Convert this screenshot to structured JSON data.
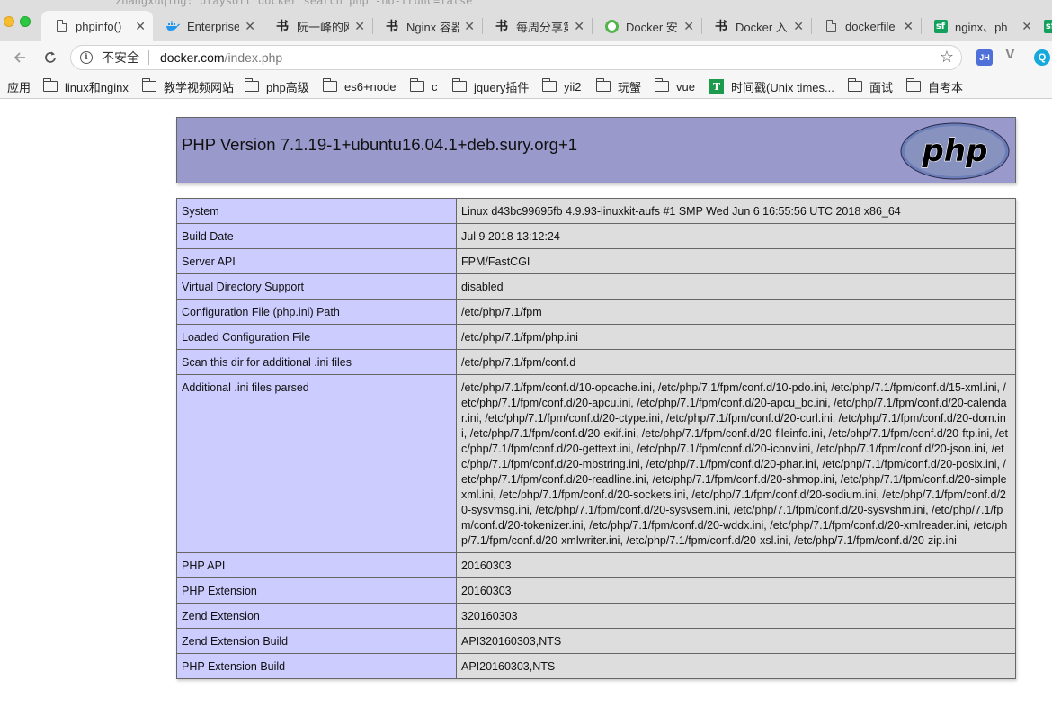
{
  "terminal_overlay": "zhangxuqing:  playsoft docker search php  -no-trunc=false",
  "tabs": [
    {
      "title": "phpinfo()",
      "icon": "document-icon",
      "active": true
    },
    {
      "title": "Enterprise",
      "icon": "docker-whale-icon"
    },
    {
      "title": "阮一峰的网",
      "icon": "jianshu-icon"
    },
    {
      "title": "Nginx 容器",
      "icon": "jianshu-icon"
    },
    {
      "title": "每周分享第",
      "icon": "jianshu-icon"
    },
    {
      "title": "Docker 安",
      "icon": "green-ring-icon"
    },
    {
      "title": "Docker 入",
      "icon": "jianshu-icon"
    },
    {
      "title": "dockerfile",
      "icon": "document-icon"
    },
    {
      "title": "nginx、ph",
      "icon": "segmentfault-icon"
    }
  ],
  "address_bar": {
    "security_label": "不安全",
    "url_host": "docker.com",
    "url_path": "/index.php"
  },
  "extensions": [
    "JH",
    "V",
    "Q"
  ],
  "bookmarks": [
    {
      "label": "应用",
      "icon": "none"
    },
    {
      "label": "linux和nginx",
      "icon": "folder-icon"
    },
    {
      "label": "教学视频网站",
      "icon": "folder-icon"
    },
    {
      "label": "php高级",
      "icon": "folder-icon"
    },
    {
      "label": "es6+node",
      "icon": "folder-icon"
    },
    {
      "label": "c",
      "icon": "folder-icon"
    },
    {
      "label": "jquery插件",
      "icon": "folder-icon"
    },
    {
      "label": "yii2",
      "icon": "folder-icon"
    },
    {
      "label": "玩蟹",
      "icon": "folder-icon"
    },
    {
      "label": "vue",
      "icon": "folder-icon"
    },
    {
      "label": "时间戳(Unix times...",
      "icon": "timestamp-icon"
    },
    {
      "label": "面试",
      "icon": "folder-icon"
    },
    {
      "label": "自考本",
      "icon": "folder-icon"
    }
  ],
  "php": {
    "version_title": "PHP Version 7.1.19-1+ubuntu16.04.1+deb.sury.org+1",
    "logo_text": "php",
    "rows": [
      {
        "key": "System",
        "value": "Linux d43bc99695fb 4.9.93-linuxkit-aufs #1 SMP Wed Jun 6 16:55:56 UTC 2018 x86_64"
      },
      {
        "key": "Build Date",
        "value": "Jul 9 2018 13:12:24"
      },
      {
        "key": "Server API",
        "value": "FPM/FastCGI"
      },
      {
        "key": "Virtual Directory Support",
        "value": "disabled"
      },
      {
        "key": "Configuration File (php.ini) Path",
        "value": "/etc/php/7.1/fpm"
      },
      {
        "key": "Loaded Configuration File",
        "value": "/etc/php/7.1/fpm/php.ini"
      },
      {
        "key": "Scan this dir for additional .ini files",
        "value": "/etc/php/7.1/fpm/conf.d"
      },
      {
        "key": "Additional .ini files parsed",
        "value": "/etc/php/7.1/fpm/conf.d/10-opcache.ini, /etc/php/7.1/fpm/conf.d/10-pdo.ini, /etc/php/7.1/fpm/conf.d/15-xml.ini, /etc/php/7.1/fpm/conf.d/20-apcu.ini, /etc/php/7.1/fpm/conf.d/20-apcu_bc.ini, /etc/php/7.1/fpm/conf.d/20-calendar.ini, /etc/php/7.1/fpm/conf.d/20-ctype.ini, /etc/php/7.1/fpm/conf.d/20-curl.ini, /etc/php/7.1/fpm/conf.d/20-dom.ini, /etc/php/7.1/fpm/conf.d/20-exif.ini, /etc/php/7.1/fpm/conf.d/20-fileinfo.ini, /etc/php/7.1/fpm/conf.d/20-ftp.ini, /etc/php/7.1/fpm/conf.d/20-gettext.ini, /etc/php/7.1/fpm/conf.d/20-iconv.ini, /etc/php/7.1/fpm/conf.d/20-json.ini, /etc/php/7.1/fpm/conf.d/20-mbstring.ini, /etc/php/7.1/fpm/conf.d/20-phar.ini, /etc/php/7.1/fpm/conf.d/20-posix.ini, /etc/php/7.1/fpm/conf.d/20-readline.ini, /etc/php/7.1/fpm/conf.d/20-shmop.ini, /etc/php/7.1/fpm/conf.d/20-simplexml.ini, /etc/php/7.1/fpm/conf.d/20-sockets.ini, /etc/php/7.1/fpm/conf.d/20-sodium.ini, /etc/php/7.1/fpm/conf.d/20-sysvmsg.ini, /etc/php/7.1/fpm/conf.d/20-sysvsem.ini, /etc/php/7.1/fpm/conf.d/20-sysvshm.ini, /etc/php/7.1/fpm/conf.d/20-tokenizer.ini, /etc/php/7.1/fpm/conf.d/20-wddx.ini, /etc/php/7.1/fpm/conf.d/20-xmlreader.ini, /etc/php/7.1/fpm/conf.d/20-xmlwriter.ini, /etc/php/7.1/fpm/conf.d/20-xsl.ini, /etc/php/7.1/fpm/conf.d/20-zip.ini"
      },
      {
        "key": "PHP API",
        "value": "20160303"
      },
      {
        "key": "PHP Extension",
        "value": "20160303"
      },
      {
        "key": "Zend Extension",
        "value": "320160303"
      },
      {
        "key": "Zend Extension Build",
        "value": "API320160303,NTS"
      },
      {
        "key": "PHP Extension Build",
        "value": "API20160303,NTS"
      }
    ]
  },
  "colors": {
    "php_header_bg": "#9999cc",
    "key_cell_bg": "#ccccff",
    "value_cell_bg": "#dddddd",
    "tabstrip_bg": "#dedede"
  }
}
